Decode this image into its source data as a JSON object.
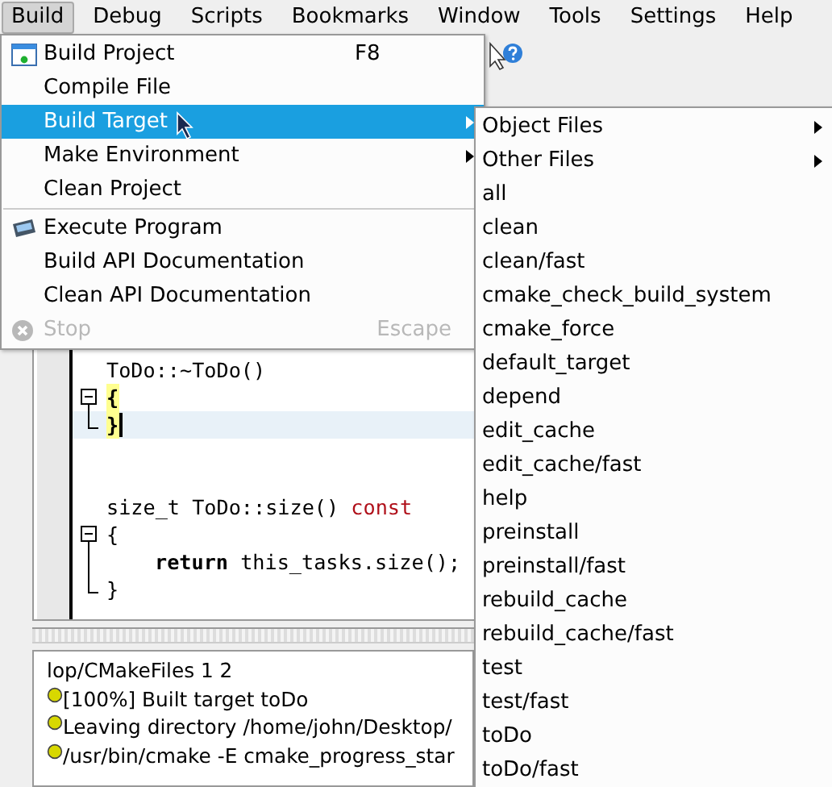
{
  "menubar": [
    {
      "label": "Build",
      "selected": true
    },
    {
      "label": "Debug",
      "selected": false
    },
    {
      "label": "Scripts",
      "selected": false
    },
    {
      "label": "Bookmarks",
      "selected": false
    },
    {
      "label": "Window",
      "selected": false
    },
    {
      "label": "Tools",
      "selected": false
    },
    {
      "label": "Settings",
      "selected": false
    },
    {
      "label": "Help",
      "selected": false
    }
  ],
  "build_menu": [
    {
      "kind": "item",
      "label": "Build Project",
      "shortcut": "F8",
      "selected": false,
      "disabled": false,
      "submenu": false
    },
    {
      "kind": "item",
      "label": "Compile File",
      "selected": false,
      "disabled": false,
      "submenu": false
    },
    {
      "kind": "item",
      "label": "Build Target",
      "selected": true,
      "disabled": false,
      "submenu": true
    },
    {
      "kind": "item",
      "label": "Make Environment",
      "selected": false,
      "disabled": false,
      "submenu": true
    },
    {
      "kind": "item",
      "label": "Clean Project",
      "selected": false,
      "disabled": false,
      "submenu": false
    },
    {
      "kind": "separator"
    },
    {
      "kind": "item",
      "label": "Execute Program",
      "selected": false,
      "disabled": false,
      "submenu": false
    },
    {
      "kind": "item",
      "label": "Build API Documentation",
      "selected": false,
      "disabled": false,
      "submenu": false
    },
    {
      "kind": "item",
      "label": "Clean API Documentation",
      "selected": false,
      "disabled": false,
      "submenu": false
    },
    {
      "kind": "item",
      "label": "Stop",
      "shortcut": "Escape",
      "selected": false,
      "disabled": true,
      "submenu": false
    }
  ],
  "build_target_menu": [
    {
      "label": "Object Files",
      "submenu": true
    },
    {
      "label": "Other Files",
      "submenu": true
    },
    {
      "label": "all",
      "submenu": false
    },
    {
      "label": "clean",
      "submenu": false
    },
    {
      "label": "clean/fast",
      "submenu": false
    },
    {
      "label": "cmake_check_build_system",
      "submenu": false
    },
    {
      "label": "cmake_force",
      "submenu": false
    },
    {
      "label": "default_target",
      "submenu": false
    },
    {
      "label": "depend",
      "submenu": false
    },
    {
      "label": "edit_cache",
      "submenu": false
    },
    {
      "label": "edit_cache/fast",
      "submenu": false
    },
    {
      "label": "help",
      "submenu": false
    },
    {
      "label": "preinstall",
      "submenu": false
    },
    {
      "label": "preinstall/fast",
      "submenu": false
    },
    {
      "label": "rebuild_cache",
      "submenu": false
    },
    {
      "label": "rebuild_cache/fast",
      "submenu": false
    },
    {
      "label": "test",
      "submenu": false
    },
    {
      "label": "test/fast",
      "submenu": false
    },
    {
      "label": "toDo",
      "submenu": false
    },
    {
      "label": "toDo/fast",
      "submenu": false
    }
  ],
  "editor": {
    "lines": [
      {
        "kind": "plain",
        "current": false,
        "segments": [
          {
            "kind": "plain",
            "text": "ToDo::~ToDo()"
          }
        ]
      },
      {
        "kind": "fold_start",
        "current": false,
        "segments": [
          {
            "kind": "bracket",
            "text": "{"
          }
        ]
      },
      {
        "kind": "fold_end",
        "current": true,
        "segments": [
          {
            "kind": "bracket",
            "text": "}"
          }
        ]
      },
      {
        "kind": "plain",
        "current": false
      },
      {
        "kind": "plain",
        "current": false
      },
      {
        "kind": "plain",
        "current": false,
        "segments": [
          {
            "kind": "plain",
            "text": "size_t ToDo::size() "
          },
          {
            "kind": "keyword",
            "text": "const"
          }
        ]
      },
      {
        "kind": "fold_start",
        "current": false,
        "segments": [
          {
            "kind": "plain",
            "text": "{"
          }
        ]
      },
      {
        "kind": "fold_mid",
        "current": false,
        "indented": true,
        "segments": [
          {
            "kind": "bold",
            "text": "return"
          },
          {
            "kind": "plain",
            "text": " this_tasks.size();"
          }
        ]
      },
      {
        "kind": "fold_end",
        "current": false,
        "segments": [
          {
            "kind": "plain",
            "text": "}"
          }
        ]
      }
    ]
  },
  "output": [
    {
      "dot": false,
      "text": "lop/CMakeFiles 1 2"
    },
    {
      "dot": true,
      "text": "[100%] Built target toDo"
    },
    {
      "dot": true,
      "text": "Leaving directory /home/john/Desktop/"
    },
    {
      "dot": true,
      "text": "/usr/bin/cmake -E cmake_progress_star"
    }
  ]
}
